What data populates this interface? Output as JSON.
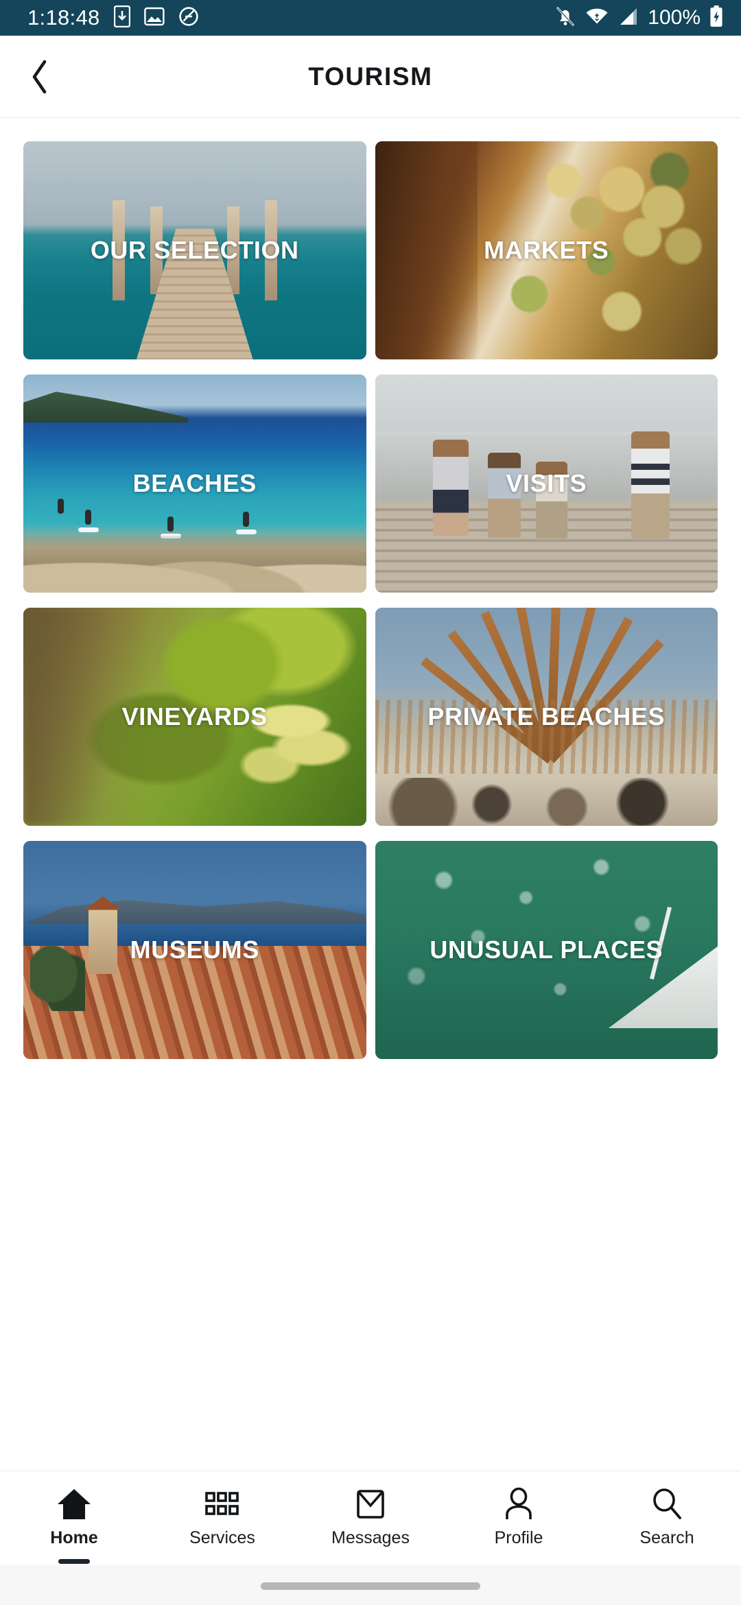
{
  "status_bar": {
    "clock": "1:18:48",
    "battery_percent": "100%",
    "icons": [
      "download-icon",
      "image-icon",
      "do-not-disturb-icon",
      "bell-off-icon",
      "wifi-icon",
      "cellular-signal-icon",
      "battery-charging-icon"
    ],
    "background_color": "#14455a",
    "foreground_color": "#ffffff"
  },
  "app_bar": {
    "title": "TOURISM",
    "back_icon": "chevron-left-icon"
  },
  "categories": [
    {
      "label": "OUR SELECTION",
      "image": "wooden-pier-turquoise-sea",
      "photo_class": "ph-pier"
    },
    {
      "label": "MARKETS",
      "image": "olives-in-market-basket",
      "photo_class": "ph-market"
    },
    {
      "label": "BEACHES",
      "image": "blue-bay-with-paddleboarders",
      "photo_class": "ph-bay"
    },
    {
      "label": "VISITS",
      "image": "children-running-on-jetty",
      "photo_class": "ph-kids"
    },
    {
      "label": "VINEYARDS",
      "image": "vine-leaves-and-grapes",
      "photo_class": "ph-vine"
    },
    {
      "label": "PRIVATE BEACHES",
      "image": "wooden-parasol-ribs",
      "photo_class": "ph-parasol"
    },
    {
      "label": "MUSEUMS",
      "image": "village-rooftops-and-bay",
      "photo_class": "ph-village"
    },
    {
      "label": "UNUSUAL PLACES",
      "image": "green-water-with-boat",
      "photo_class": "ph-green"
    }
  ],
  "bottom_nav": {
    "active_index": 0,
    "items": [
      {
        "label": "Home",
        "icon": "home-icon"
      },
      {
        "label": "Services",
        "icon": "grid-squares-icon"
      },
      {
        "label": "Messages",
        "icon": "envelope-icon"
      },
      {
        "label": "Profile",
        "icon": "person-icon"
      },
      {
        "label": "Search",
        "icon": "magnifier-icon"
      }
    ]
  }
}
